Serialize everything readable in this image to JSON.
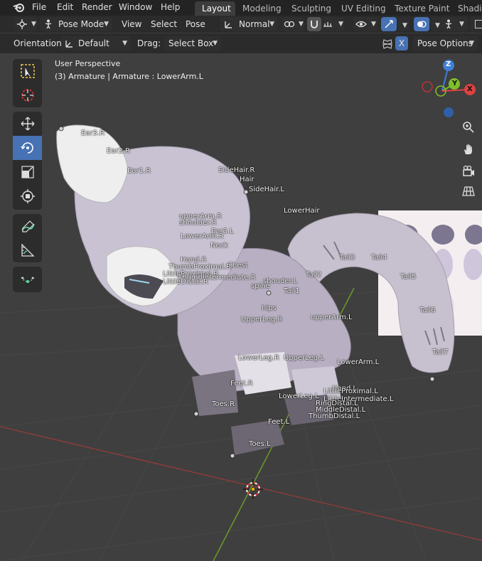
{
  "menubar": {
    "items": [
      "File",
      "Edit",
      "Render",
      "Window",
      "Help"
    ],
    "workspaces": [
      "Layout",
      "Modeling",
      "Sculpting",
      "UV Editing",
      "Texture Paint",
      "Shadin"
    ]
  },
  "header": {
    "mode": "Pose Mode",
    "menus": [
      "View",
      "Select",
      "Pose"
    ],
    "transform_orientation": "Normal"
  },
  "tool_settings": {
    "orientation_label": "Orientation:",
    "orientation_value": "Default",
    "drag_label": "Drag:",
    "drag_value": "Select Box",
    "mirror_x": "X",
    "pose_options": "Pose Options"
  },
  "viewport": {
    "title": "User Perspective",
    "context": "(3) Armature | Armature : LowerArm.L"
  },
  "gizmo": {
    "z": "Z",
    "y": "Y",
    "x": "X"
  },
  "bones": [
    "Ear3.R",
    "Ear2.R",
    "Ear1.R",
    "SideHair.R",
    "Hair",
    "SideHair.L",
    "LowerHair",
    "upperArm.R",
    "shoulder.R",
    "Ear3.L",
    "LowerArm.R",
    "Neck",
    "Chest",
    "Hand.R",
    "ThumbProximal.R",
    "LittleProximal.R",
    "ThumbIntermediate.R",
    "LittleDistal.R",
    "spine",
    "shouder.L",
    "Tail1",
    "Tail2",
    "Tail3",
    "Tail4",
    "Tail5",
    "Tail6",
    "Tail7",
    "hips",
    "UpperLeg.R",
    "upperArm.L",
    "LowerLeg.R",
    "UpperLeg.L",
    "LowerArm.L",
    "Feet.R",
    "Toes.R",
    "LowerLeg.L",
    "Hand.L",
    "LittleProximal.L",
    "LittleIntermediate.L",
    "RingDistal.L",
    "MiddleDistal.L",
    "ThumbDistal.L",
    "Feet.L",
    "Toes.L"
  ]
}
